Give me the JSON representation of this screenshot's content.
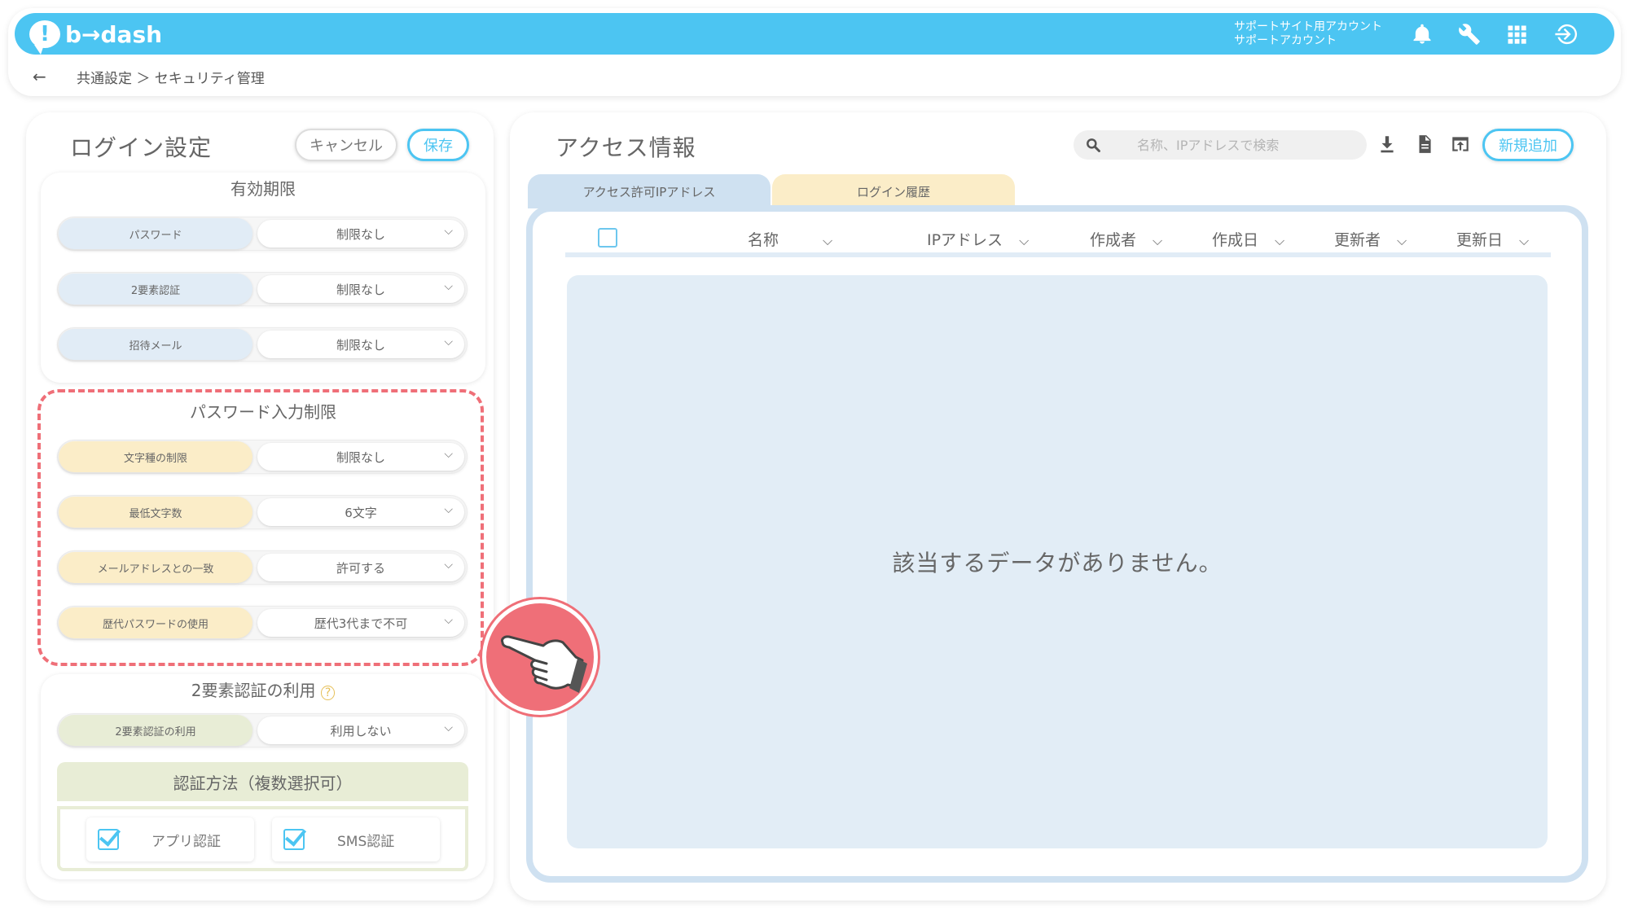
{
  "header": {
    "logo_mark": "!",
    "logo_text": "b→dash",
    "account_line1": "サポートサイト用アカウント",
    "account_line2": "サポートアカウント",
    "icons": [
      "bell-icon",
      "wrench-icon",
      "grid-icon",
      "logout-icon"
    ],
    "accent_color": "#4cc5f2"
  },
  "breadcrumb": {
    "back": "←",
    "path": "共通設定 ＞ セキュリティ管理"
  },
  "login_settings": {
    "title": "ログイン設定",
    "cancel_label": "キャンセル",
    "save_label": "保存",
    "expiry": {
      "title": "有効期限",
      "rows": [
        {
          "label": "パスワード",
          "value": "制限なし"
        },
        {
          "label": "2要素認証",
          "value": "制限なし"
        },
        {
          "label": "招待メール",
          "value": "制限なし"
        }
      ]
    },
    "password_restriction": {
      "title": "パスワード入力制限",
      "rows": [
        {
          "label": "文字種の制限",
          "value": "制限なし"
        },
        {
          "label": "最低文字数",
          "value": "6文字"
        },
        {
          "label": "メールアドレスとの一致",
          "value": "許可する"
        },
        {
          "label": "歴代パスワードの使用",
          "value": "歴代3代まで不可"
        }
      ],
      "highlight_color": "#ef6f78"
    },
    "two_factor": {
      "title": "2要素認証の利用",
      "help": "?",
      "rows": [
        {
          "label": "2要素認証の利用",
          "value": "利用しない"
        }
      ],
      "methods_title": "認証方法（複数選択可）",
      "methods": [
        {
          "label": "アプリ認証",
          "checked": true
        },
        {
          "label": "SMS認証",
          "checked": true
        }
      ]
    }
  },
  "access_info": {
    "title": "アクセス情報",
    "search_placeholder": "名称、IPアドレスで検索",
    "new_button": "新規追加",
    "tabs": [
      {
        "label": "アクセス許可IPアドレス",
        "active": true
      },
      {
        "label": "ログイン履歴",
        "active": false
      }
    ],
    "columns": [
      "名称",
      "IPアドレス",
      "作成者",
      "作成日",
      "更新者",
      "更新日"
    ],
    "empty_message": "該当するデータがありません。"
  }
}
